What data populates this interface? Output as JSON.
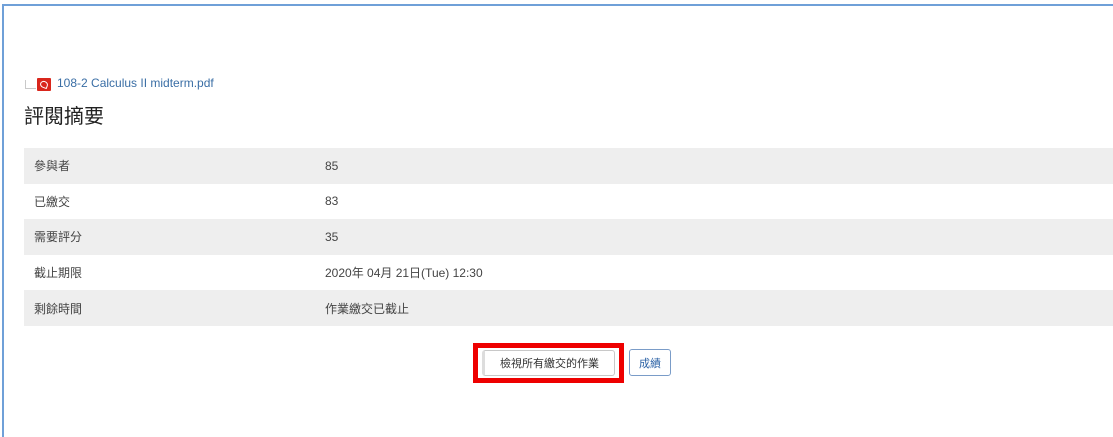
{
  "file": {
    "icon": "pdf-icon",
    "name": "108-2 Calculus II midterm.pdf"
  },
  "title": "評閱摘要",
  "summary": [
    {
      "label": "參與者",
      "value": "85"
    },
    {
      "label": "已繳交",
      "value": "83"
    },
    {
      "label": "需要評分",
      "value": "35"
    },
    {
      "label": "截止期限",
      "value": "2020年 04月 21日(Tue) 12:30"
    },
    {
      "label": "剩餘時間",
      "value": "作業繳交已截止"
    }
  ],
  "buttons": {
    "view_all": "檢視所有繳交的作業",
    "grade": "成績"
  },
  "colors": {
    "highlight": "#ee0000",
    "link": "#3a6ea5",
    "pdf": "#d9261c",
    "row_stripe": "#eeeeee"
  }
}
